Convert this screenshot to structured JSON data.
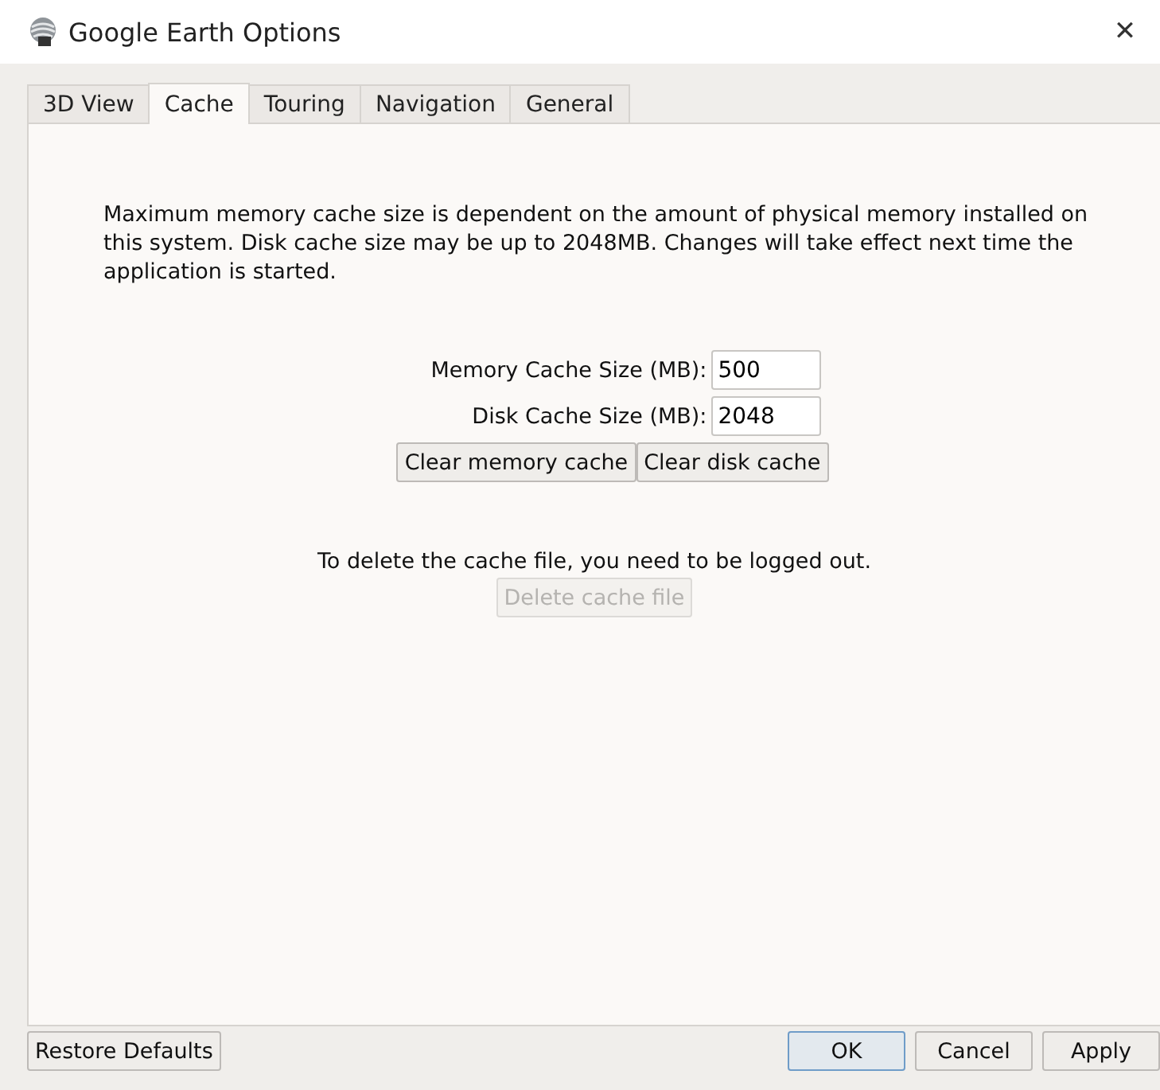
{
  "window": {
    "title": "Google Earth Options",
    "close": "✕"
  },
  "tabs": [
    {
      "label": "3D View",
      "selected": false
    },
    {
      "label": "Cache",
      "selected": true
    },
    {
      "label": "Touring",
      "selected": false
    },
    {
      "label": "Navigation",
      "selected": false
    },
    {
      "label": "General",
      "selected": false
    }
  ],
  "description": "Maximum memory cache size is dependent on the amount of physical memory installed on this system. Disk cache size may be up to 2048MB. Changes will take effect next time the application is started.",
  "fields": [
    {
      "label": "Memory Cache Size (MB):",
      "value": "500"
    },
    {
      "label": "Disk Cache Size (MB):",
      "value": "2048"
    }
  ],
  "cache_buttons": [
    {
      "label": "Clear memory cache",
      "disabled": false
    },
    {
      "label": "Clear disk cache",
      "disabled": false
    }
  ],
  "delete_note": "To delete the cache file, you need to be logged out.",
  "delete_button": {
    "label": "Delete cache file",
    "disabled": true
  },
  "restore_button": "Restore Defaults",
  "dialog_buttons": [
    {
      "label": "OK",
      "default": true
    },
    {
      "label": "Cancel",
      "default": false
    },
    {
      "label": "Apply",
      "default": false
    }
  ]
}
